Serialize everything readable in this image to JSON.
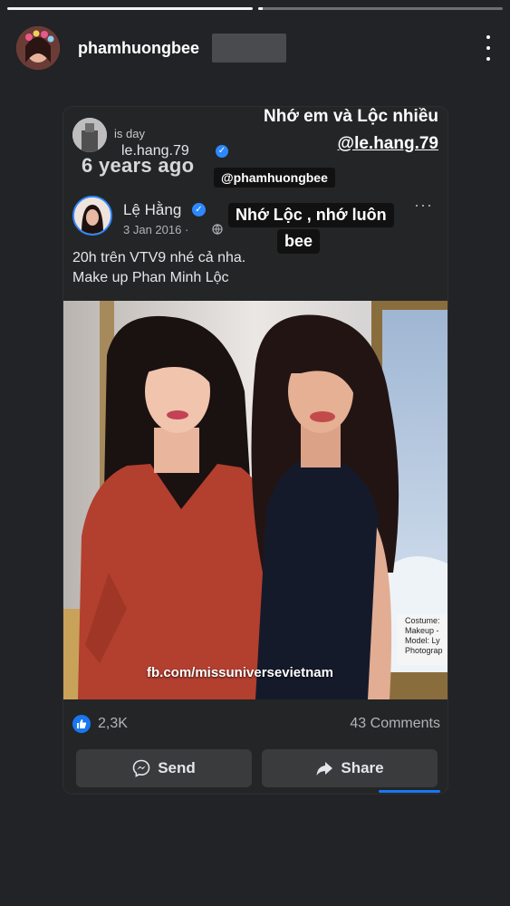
{
  "story": {
    "progress_segments": [
      1.0,
      0.02
    ],
    "username": "phamhuongbee"
  },
  "card": {
    "memory": {
      "on_this_day": "is day",
      "handle": "le.hang.79",
      "years_ago": "6 years ago"
    },
    "stickers": {
      "caption_line1": "Nhớ em và Lộc nhiều",
      "caption_line2": "@le.hang.79",
      "mention": "@phamhuongbee",
      "note_line1": "Nhớ Lộc , nhớ luôn",
      "note_line2": "bee"
    },
    "post": {
      "author": "Lệ Hằng",
      "date": "3 Jan 2016 ·",
      "text_line1": "20h trên VTV9 nhé cả nha.",
      "text_line2": "Make up Phan Minh Lộc",
      "more": "···",
      "photo_watermark": "fb.com/missuniversevietnam",
      "photo_caption_text": "Costume:\nMakeup -\nModel: Ly\nPhotograp"
    },
    "reactions": {
      "likes": "2,3K",
      "comments": "43 Comments"
    },
    "actions": {
      "send_label": "Send",
      "share_label": "Share"
    }
  },
  "icons": {
    "like": "like-icon",
    "messenger": "messenger-icon",
    "share": "share-icon",
    "globe": "globe-icon",
    "verified": "verified-icon",
    "more": "more-vertical-icon"
  },
  "colors": {
    "background": "#222326",
    "card": "#242526",
    "accent": "#1877f2",
    "button": "#3a3b3c"
  }
}
